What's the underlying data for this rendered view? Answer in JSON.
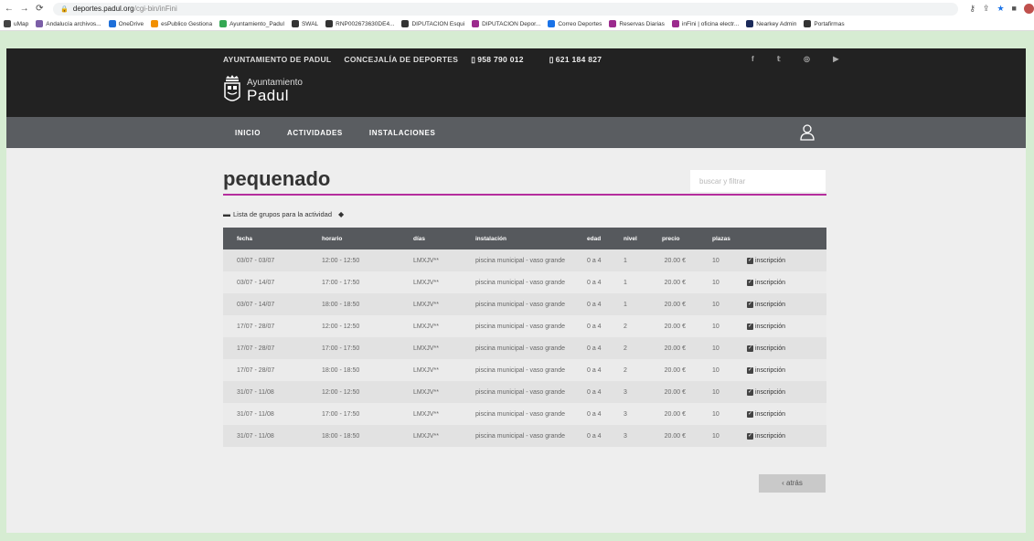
{
  "browser": {
    "url_host": "deportes.padul.org",
    "url_path": "/cgi-bin/inFini",
    "bookmarks": [
      {
        "label": "uMap",
        "color": "#444"
      },
      {
        "label": "Andalucía archivos...",
        "color": "#7b5ea7"
      },
      {
        "label": "OneDrive",
        "color": "#1e6fd9"
      },
      {
        "label": "esPublico Gestiona",
        "color": "#f29000"
      },
      {
        "label": "Ayuntamiento_Padul",
        "color": "#34a853"
      },
      {
        "label": "SWAL",
        "color": "#333"
      },
      {
        "label": "RNP002673630DE4...",
        "color": "#333"
      },
      {
        "label": "DIPUTACION Esqui",
        "color": "#333"
      },
      {
        "label": "DIPUTACION Depor...",
        "color": "#9b2a8d"
      },
      {
        "label": "Correo Deportes",
        "color": "#1a73e8"
      },
      {
        "label": "Reservas Diarias",
        "color": "#9b2a8d"
      },
      {
        "label": "inFini | oficina electr...",
        "color": "#9b2a8d"
      },
      {
        "label": "Nearkey Admin",
        "color": "#1b2a5a"
      },
      {
        "label": "Portafirmas",
        "color": "#333"
      }
    ]
  },
  "header": {
    "org": "AYUNTAMIENTO DE PADUL",
    "dept": "CONCEJALÍA DE DEPORTES",
    "phone1": "958 790 012",
    "phone2": "621 184 827",
    "logo_line1": "Ayuntamiento",
    "logo_line2": "Padul"
  },
  "nav": [
    "INICIO",
    "ACTIVIDADES",
    "INSTALACIONES"
  ],
  "main": {
    "title": "pequenado",
    "search_placeholder": "buscar y filtrar",
    "group_label": "Lista de grupos para la actividad",
    "back_label": "‹ atrás"
  },
  "table": {
    "headers": [
      "fecha",
      "horario",
      "días",
      "instalación",
      "edad",
      "nivel",
      "precio",
      "plazas",
      ""
    ],
    "action_label": "inscripción",
    "rows": [
      [
        "03/07 - 03/07",
        "12:00 - 12:50",
        "LMXJV**",
        "piscina municipal - vaso grande",
        "0 a 4",
        "1",
        "20.00 €",
        "10"
      ],
      [
        "03/07 - 14/07",
        "17:00 - 17:50",
        "LMXJV**",
        "piscina municipal - vaso grande",
        "0 a 4",
        "1",
        "20.00 €",
        "10"
      ],
      [
        "03/07 - 14/07",
        "18:00 - 18:50",
        "LMXJV**",
        "piscina municipal - vaso grande",
        "0 a 4",
        "1",
        "20.00 €",
        "10"
      ],
      [
        "17/07 - 28/07",
        "12:00 - 12:50",
        "LMXJV**",
        "piscina municipal - vaso grande",
        "0 a 4",
        "2",
        "20.00 €",
        "10"
      ],
      [
        "17/07 - 28/07",
        "17:00 - 17:50",
        "LMXJV**",
        "piscina municipal - vaso grande",
        "0 a 4",
        "2",
        "20.00 €",
        "10"
      ],
      [
        "17/07 - 28/07",
        "18:00 - 18:50",
        "LMXJV**",
        "piscina municipal - vaso grande",
        "0 a 4",
        "2",
        "20.00 €",
        "10"
      ],
      [
        "31/07 - 11/08",
        "12:00 - 12:50",
        "LMXJV**",
        "piscina municipal - vaso grande",
        "0 a 4",
        "3",
        "20.00 €",
        "10"
      ],
      [
        "31/07 - 11/08",
        "17:00 - 17:50",
        "LMXJV**",
        "piscina municipal - vaso grande",
        "0 a 4",
        "3",
        "20.00 €",
        "10"
      ],
      [
        "31/07 - 11/08",
        "18:00 - 18:50",
        "LMXJV**",
        "piscina municipal - vaso grande",
        "0 a 4",
        "3",
        "20.00 €",
        "10"
      ]
    ]
  }
}
